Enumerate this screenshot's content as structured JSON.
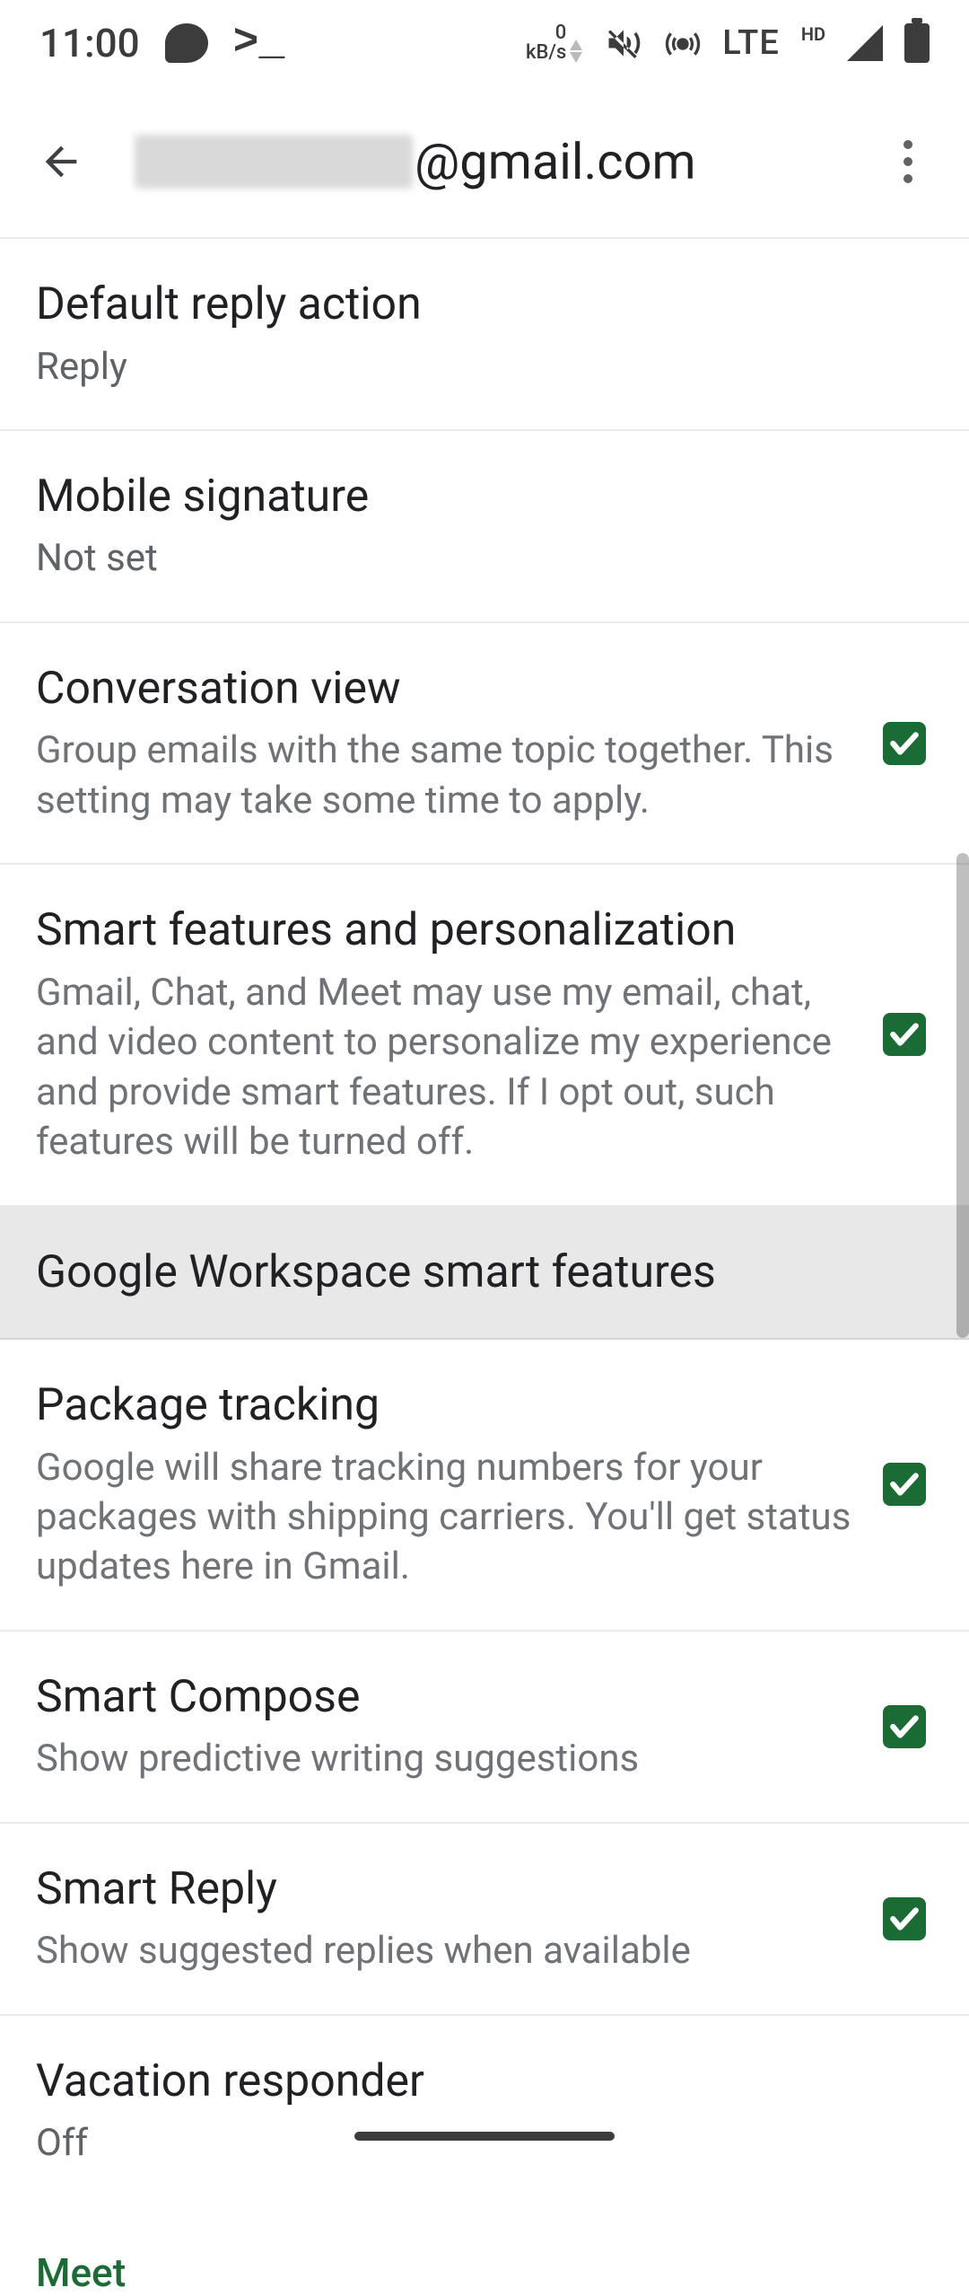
{
  "statusbar": {
    "time": "11:00",
    "lte": "LTE",
    "hd": "HD",
    "kbs_top": "0",
    "kbs_bot": "kB/s"
  },
  "header": {
    "account_suffix": "@gmail.com"
  },
  "settings": {
    "default_reply": {
      "title": "Default reply action",
      "value": "Reply"
    },
    "signature": {
      "title": "Mobile signature",
      "value": "Not set"
    },
    "conversation_view": {
      "title": "Conversation view",
      "desc": "Group emails with the same topic together. This setting may take some time to apply."
    },
    "smart_personalization": {
      "title": "Smart features and personalization",
      "desc": "Gmail, Chat, and Meet may use my email, chat, and video content to personalize my experience and provide smart features. If I opt out, such features will be turned off."
    },
    "workspace_smart": {
      "title": "Google Workspace smart features"
    },
    "package_tracking": {
      "title": "Package tracking",
      "desc": "Google will share tracking numbers for your packages with shipping carriers. You'll get status updates here in Gmail."
    },
    "smart_compose": {
      "title": "Smart Compose",
      "desc": "Show predictive writing suggestions"
    },
    "smart_reply": {
      "title": "Smart Reply",
      "desc": "Show suggested replies when available"
    },
    "vacation": {
      "title": "Vacation responder",
      "value": "Off"
    }
  },
  "sections": {
    "meet": "Meet"
  }
}
